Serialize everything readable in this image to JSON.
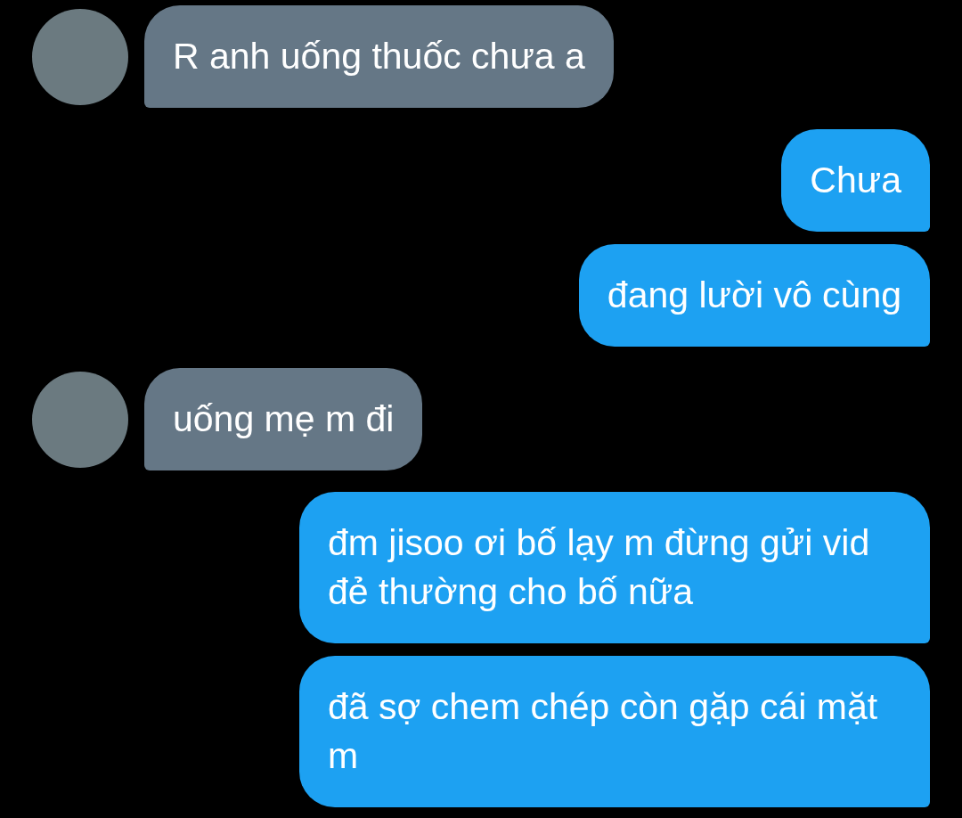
{
  "messages": [
    {
      "kind": "incoming",
      "text": "R anh uống thuốc chưa a"
    },
    {
      "kind": "outgoing",
      "text": "Chưa"
    },
    {
      "kind": "outgoing",
      "text": "đang lười vô cùng"
    },
    {
      "kind": "incoming",
      "text": "uống mẹ m đi"
    },
    {
      "kind": "outgoing",
      "text": "đm jisoo ơi bố lạy m đừng gửi vid đẻ thường cho bố nữa"
    },
    {
      "kind": "outgoing",
      "text": "đã sợ chem chép còn gặp cái mặt m"
    }
  ]
}
